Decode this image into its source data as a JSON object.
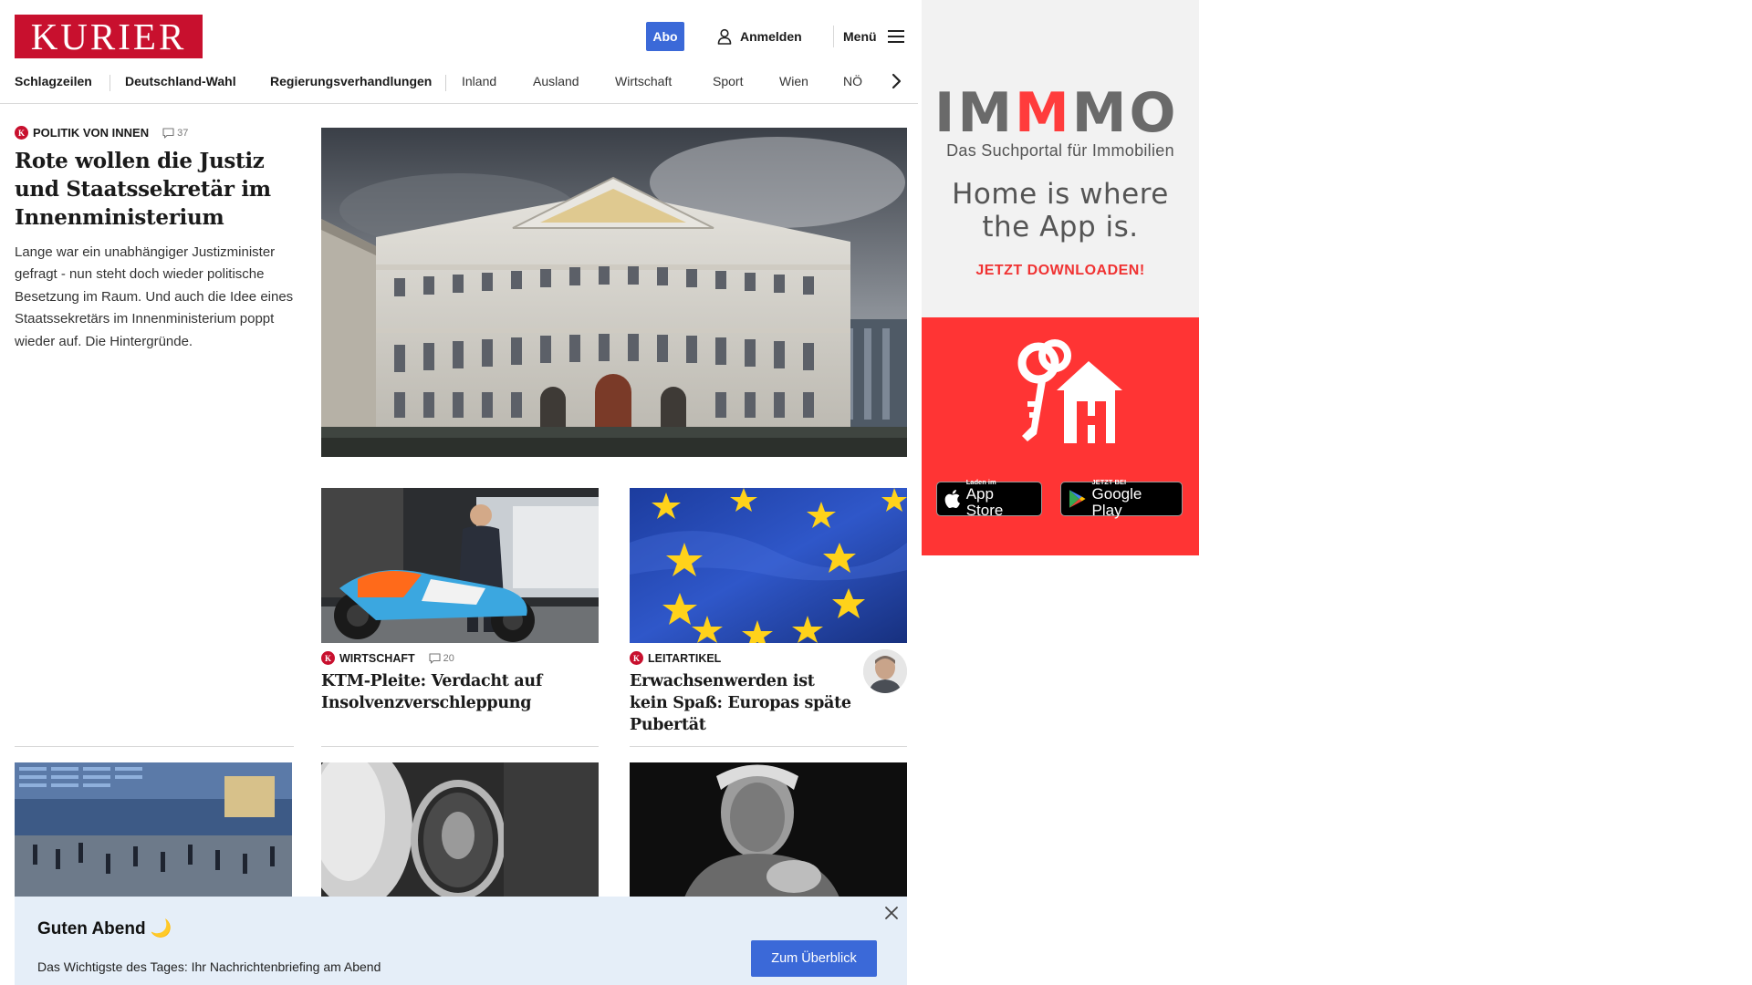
{
  "brand": {
    "logo_text": "KURIER"
  },
  "header": {
    "abo_label": "Abo",
    "login_label": "Anmelden",
    "menu_label": "Menü"
  },
  "nav": {
    "items": [
      "Schlagzeilen",
      "Deutschland-Wahl",
      "Regierungsverhandlungen",
      "Inland",
      "Ausland",
      "Wirtschaft",
      "Sport",
      "Wien",
      "NÖ"
    ]
  },
  "lead": {
    "kicker": "POLITIK VON INNEN",
    "comment_count": "37",
    "headline": "Rote wollen die Justiz und Staatssekretär im Innenministerium",
    "teaser": "Lange war ein unabhängiger Justizminister gefragt - nun steht doch wieder politische Besetzung im Raum. Und auch die Idee eines Staatssekretärs im Innenministerium poppt wieder auf. Die Hintergründe."
  },
  "cards": [
    {
      "kicker": "WIRTSCHAFT",
      "comment_count": "20",
      "headline": "KTM-Pleite: Verdacht auf Insolvenzverschleppung"
    },
    {
      "kicker": "LEITARTIKEL",
      "headline": "Erwachsenwerden ist kein Spaß: Europas späte Pubertät"
    }
  ],
  "banner": {
    "title": "Guten Abend 🌙",
    "subtitle": "Das Wichtigste des Tages: Ihr Nachrichtenbriefing am Abend",
    "button_label": "Zum Überblick"
  },
  "ad": {
    "brand_i": "IM",
    "brand_m": "M",
    "brand_o": "MO",
    "tagline": "Das Suchportal für Immobilien",
    "slogan_line1": "Home is where",
    "slogan_line2": "the App is.",
    "cta": "JETZT DOWNLOADEN!",
    "appstore_small": "Laden im",
    "appstore_big": "App Store",
    "googleplay_small": "JETZT BEI",
    "googleplay_big": "Google Play"
  },
  "colors": {
    "brand_red": "#c8102e",
    "accent_blue": "#3b69d8",
    "banner_bg": "#e5eef8",
    "ad_red": "#ff3434"
  },
  "icons": [
    "user-icon",
    "hamburger-icon",
    "chevron-right-icon",
    "comment-icon",
    "close-icon",
    "apple-icon",
    "google-play-icon"
  ]
}
